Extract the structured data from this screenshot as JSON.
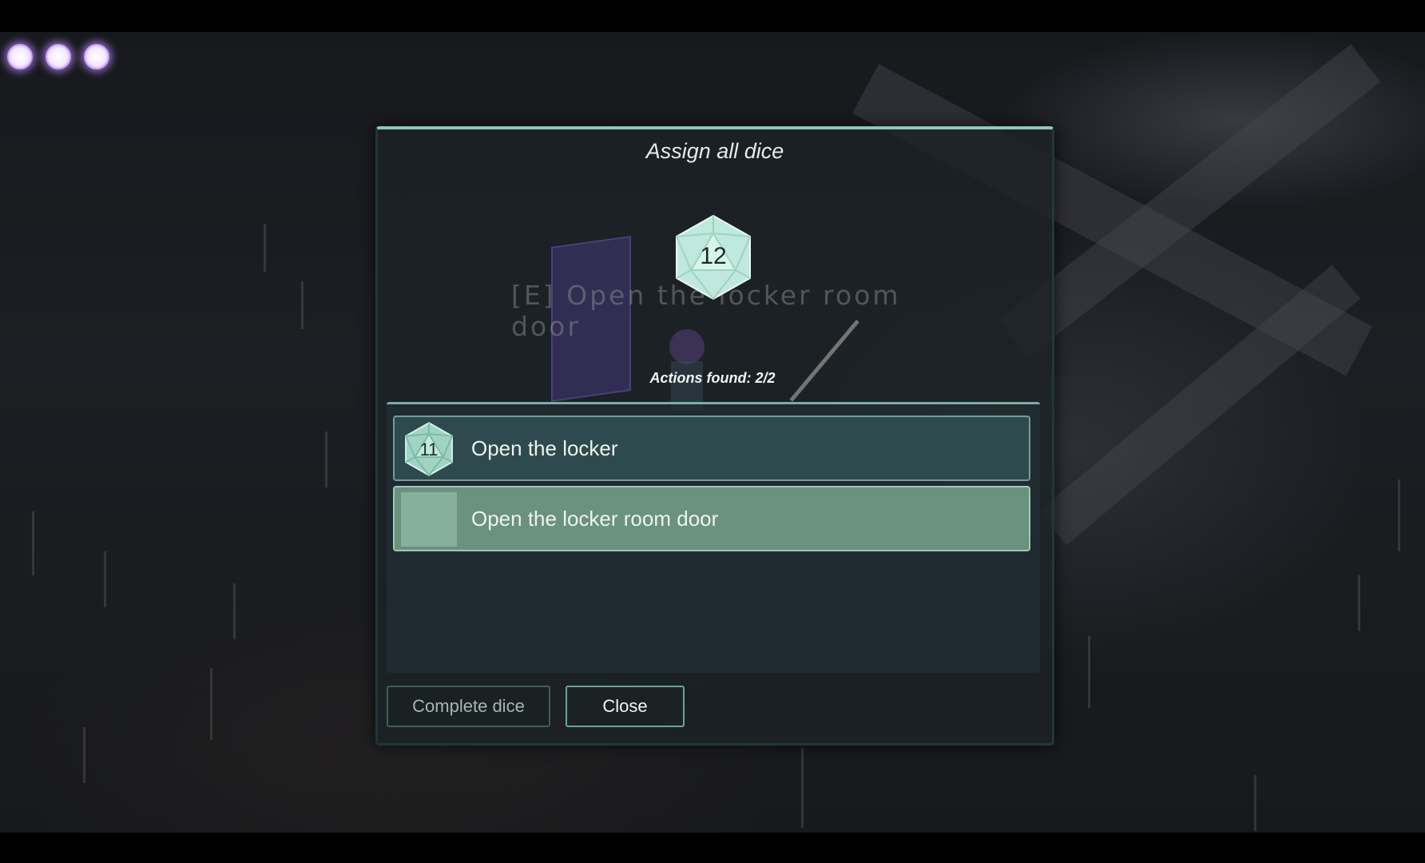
{
  "hud": {
    "pips": [
      {
        "name": "pip-1"
      },
      {
        "name": "pip-2"
      },
      {
        "name": "pip-3"
      }
    ]
  },
  "scene": {
    "prompt_text": "[E] Open the locker room door"
  },
  "dialog": {
    "title": "Assign all dice",
    "current_die": {
      "value": "12",
      "icon": "d20-icon"
    },
    "actions_found": "Actions found: 2/2",
    "actions": [
      {
        "label": "Open the locker",
        "die": "11",
        "selected": false
      },
      {
        "label": "Open the locker room door",
        "die": null,
        "selected": true
      }
    ],
    "buttons": {
      "complete": "Complete dice",
      "close": "Close"
    }
  },
  "colors": {
    "accent": "#8fc6b8",
    "die_fill": "#bfe9dc",
    "selected_row": "#6a927f",
    "pip_glow": "#d9b8ff"
  }
}
